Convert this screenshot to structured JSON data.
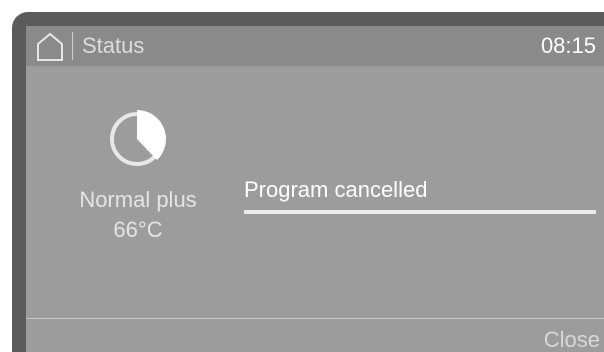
{
  "header": {
    "title": "Status",
    "time": "08:15",
    "home_icon": "home-icon"
  },
  "program": {
    "icon": "program-progress-icon",
    "name": "Normal plus",
    "temperature": "66°C"
  },
  "status": {
    "text": "Program cancelled",
    "progress": 1.0
  },
  "footer": {
    "close_label": "Close"
  },
  "colors": {
    "bezel": "#5b5b5b",
    "screen": "#9c9c9c",
    "header": "#8a8a8a",
    "text": "#ffffff"
  }
}
